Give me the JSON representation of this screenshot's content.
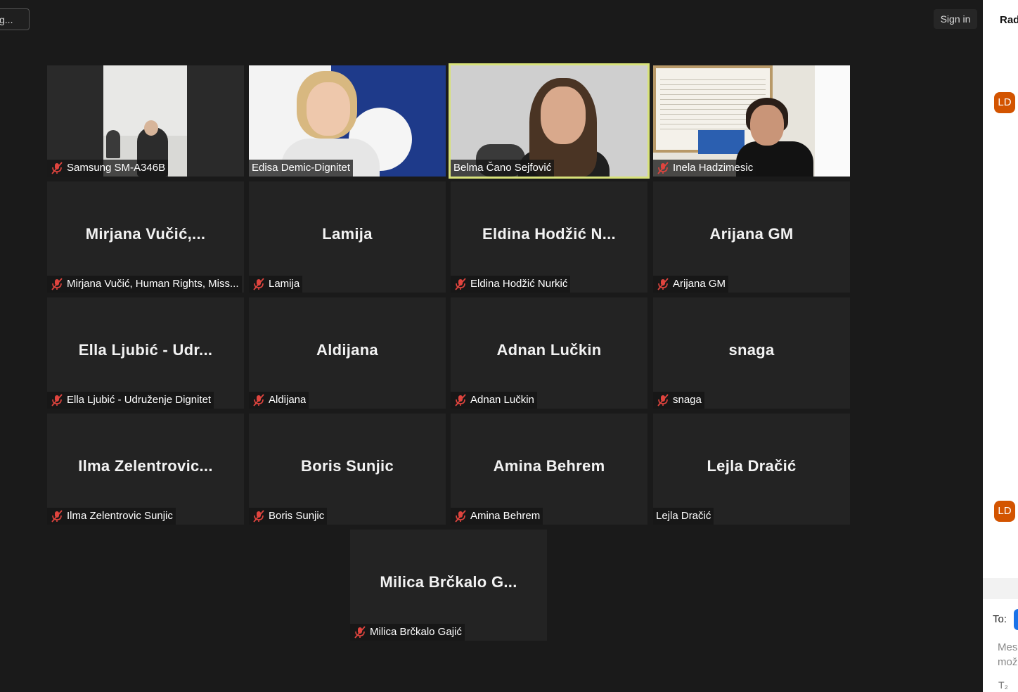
{
  "toolbar": {
    "left_pill": "g...",
    "sign_in": "Sign in"
  },
  "participants": [
    {
      "display": "",
      "label": "Samsung SM-A346B",
      "muted": true,
      "video": true
    },
    {
      "display": "",
      "label": "Edisa Demic-Dignitet",
      "muted": false,
      "video": true
    },
    {
      "display": "",
      "label": "Belma Čano Sejfović",
      "muted": false,
      "video": true,
      "active_speaker": true
    },
    {
      "display": "",
      "label": "Inela Hadzimesic",
      "muted": true,
      "video": true
    },
    {
      "display": "Mirjana  Vučić,...",
      "label": "Mirjana Vučić, Human Rights, Miss...",
      "muted": true
    },
    {
      "display": "Lamija",
      "label": "Lamija",
      "muted": true
    },
    {
      "display": "Eldina  Hodžić  N...",
      "label": "Eldina Hodžić Nurkić",
      "muted": true
    },
    {
      "display": "Arijana GM",
      "label": "Arijana GM",
      "muted": true
    },
    {
      "display": "Ella  Ljubić  -  Udr...",
      "label": "Ella Ljubić - Udruženje Dignitet",
      "muted": true
    },
    {
      "display": "Aldijana",
      "label": "Aldijana",
      "muted": true
    },
    {
      "display": "Adnan Lučkin",
      "label": "Adnan Lučkin",
      "muted": true
    },
    {
      "display": "snaga",
      "label": "snaga",
      "muted": true
    },
    {
      "display": "Ilma  Zelentrovic...",
      "label": "Ilma Zelentrovic Sunjic",
      "muted": true
    },
    {
      "display": "Boris Sunjic",
      "label": "Boris Sunjic",
      "muted": true
    },
    {
      "display": "Amina Behrem",
      "label": "Amina Behrem",
      "muted": true
    },
    {
      "display": "Lejla Dračić",
      "label": "Lejla Dračić",
      "muted": false
    },
    {
      "display": "Milica  Brčkalo  G...",
      "label": "Milica Brčkalo Gajić",
      "muted": true
    }
  ],
  "chat_panel": {
    "title": "Rad",
    "avatar_initials": "LD",
    "to_label": "To:",
    "message_placeholder": "Mes\nmož",
    "format_icon_glyph": "T₂"
  },
  "colors": {
    "active_speaker_border": "#d8e27a",
    "muted_icon": "#e0443e",
    "avatar": "#d35400"
  }
}
